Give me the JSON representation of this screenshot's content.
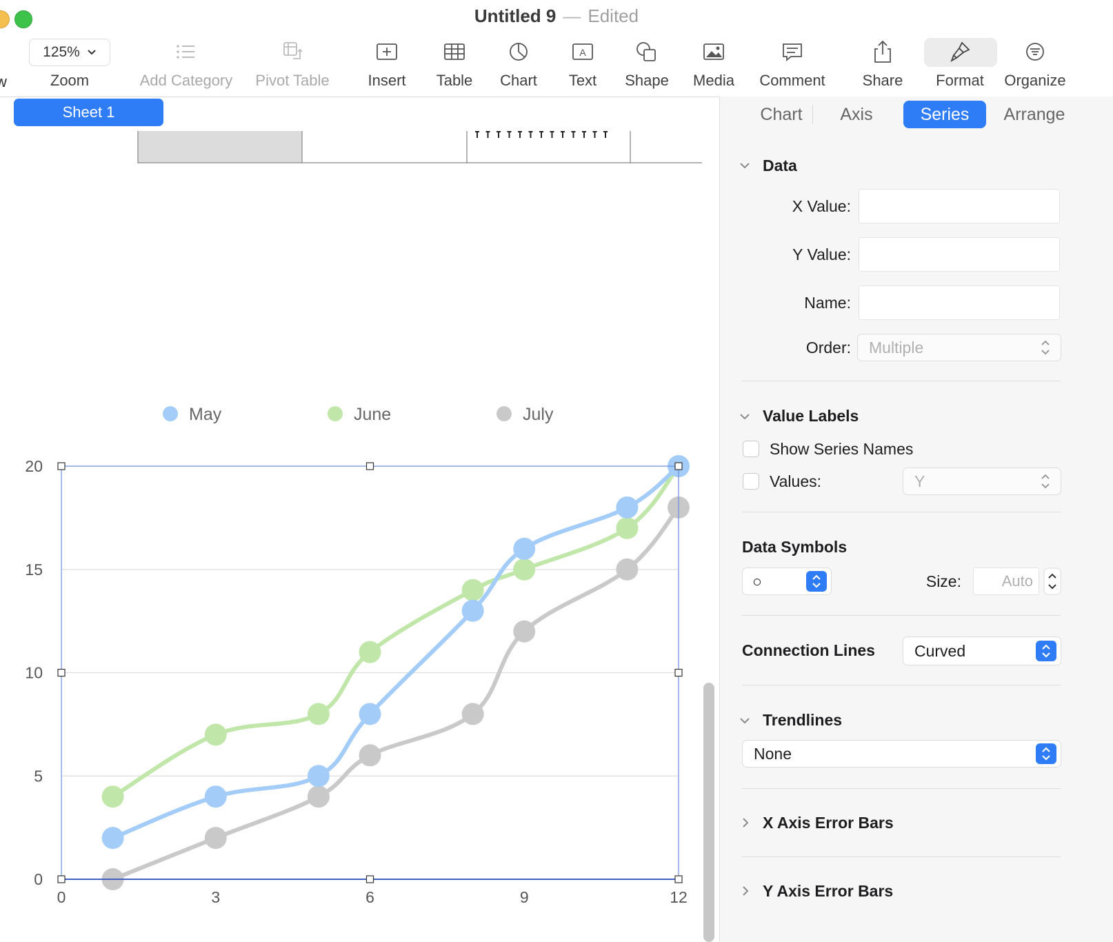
{
  "window": {
    "title": "Untitled 9",
    "separator": "—",
    "status": "Edited"
  },
  "toolbar": {
    "cut_label": "w",
    "zoom_value": "125%",
    "zoom_label": "Zoom",
    "add_category": "Add Category",
    "pivot_table": "Pivot Table",
    "insert": "Insert",
    "table": "Table",
    "chart": "Chart",
    "text": "Text",
    "shape": "Shape",
    "media": "Media",
    "comment": "Comment",
    "share": "Share",
    "format": "Format",
    "organize": "Organize"
  },
  "sheets": {
    "active": "Sheet 1"
  },
  "chart_data": {
    "type": "line",
    "connection": "curved",
    "series": [
      {
        "name": "May",
        "color": "#a3cdf8",
        "points": [
          [
            1,
            2
          ],
          [
            3,
            4
          ],
          [
            5,
            5
          ],
          [
            6,
            8
          ],
          [
            8,
            13
          ],
          [
            9,
            16
          ],
          [
            11,
            18
          ],
          [
            12,
            20
          ]
        ]
      },
      {
        "name": "June",
        "color": "#c0e7a9",
        "points": [
          [
            1,
            4
          ],
          [
            3,
            7
          ],
          [
            5,
            8
          ],
          [
            6,
            11
          ],
          [
            8,
            14
          ],
          [
            9,
            15
          ],
          [
            11,
            17
          ],
          [
            12,
            20
          ]
        ]
      },
      {
        "name": "July",
        "color": "#c9c9c9",
        "points": [
          [
            1,
            0
          ],
          [
            3,
            2
          ],
          [
            5,
            4
          ],
          [
            6,
            6
          ],
          [
            8,
            8
          ],
          [
            9,
            12
          ],
          [
            11,
            15
          ],
          [
            12,
            18
          ]
        ]
      }
    ],
    "x_ticks": [
      "0",
      "3",
      "6",
      "9",
      "12"
    ],
    "y_ticks": [
      "0",
      "5",
      "10",
      "15",
      "20"
    ],
    "xlim": [
      0,
      12
    ],
    "ylim": [
      0,
      20
    ],
    "grid": true,
    "legend_position": "top"
  },
  "inspector": {
    "tabs": [
      "Chart",
      "Axis",
      "Series",
      "Arrange"
    ],
    "active_tab": "Series",
    "data": {
      "title": "Data",
      "x_value_label": "X Value:",
      "y_value_label": "Y Value:",
      "name_label": "Name:",
      "order_label": "Order:",
      "order_value": "Multiple"
    },
    "value_labels": {
      "title": "Value Labels",
      "show_series_names": "Show Series Names",
      "values_label": "Values:",
      "values_value": "Y"
    },
    "data_symbols": {
      "title": "Data Symbols",
      "symbol": "○",
      "size_label": "Size:",
      "size_placeholder": "Auto"
    },
    "connection_lines": {
      "title": "Connection Lines",
      "value": "Curved"
    },
    "trendlines": {
      "title": "Trendlines",
      "value": "None"
    },
    "x_error_bars": "X Axis Error Bars",
    "y_error_bars": "Y Axis Error Bars"
  }
}
